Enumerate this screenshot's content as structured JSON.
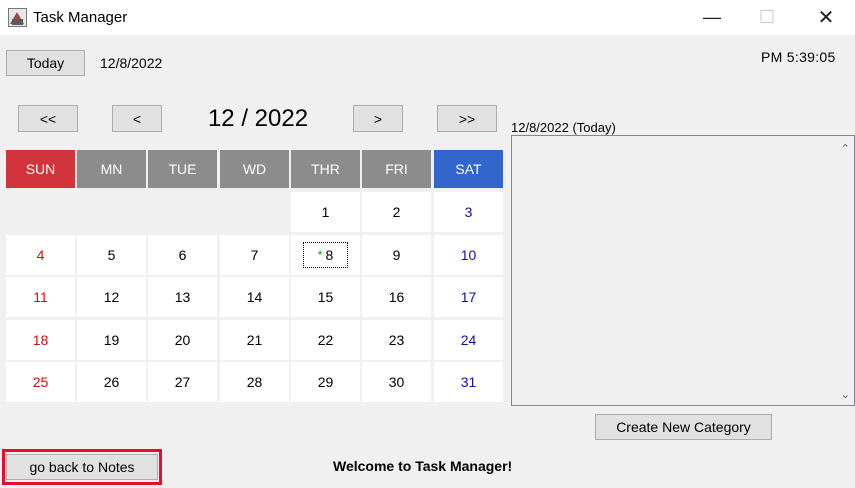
{
  "window": {
    "title": "Task Manager",
    "minimize_glyph": "—",
    "maximize_glyph": "☐",
    "close_glyph": "✕"
  },
  "toolbar": {
    "today_label": "Today",
    "current_date": "12/8/2022",
    "clock": "PM  5:39:05"
  },
  "calendar": {
    "nav": {
      "prev_year": "<<",
      "prev_month": "<",
      "next_month": ">",
      "next_year": ">>"
    },
    "month_year": "12 / 2022",
    "day_headers": [
      "SUN",
      "MN",
      "TUE",
      "WD",
      "THR",
      "FRI",
      "SAT"
    ],
    "header_colors": {
      "sun": "#d1343a",
      "weekday": "#8c8c8c",
      "sat": "#3366cc"
    },
    "weeks": [
      [
        "",
        "",
        "",
        "",
        "1",
        "2",
        "3"
      ],
      [
        "4",
        "5",
        "6",
        "7",
        "8",
        "9",
        "10"
      ],
      [
        "11",
        "12",
        "13",
        "14",
        "15",
        "16",
        "17"
      ],
      [
        "18",
        "19",
        "20",
        "21",
        "22",
        "23",
        "24"
      ],
      [
        "25",
        "26",
        "27",
        "28",
        "29",
        "30",
        "31"
      ]
    ],
    "today_day": "8",
    "today_marker": "*"
  },
  "tasks": {
    "date_label": "12/8/2022 (Today)",
    "scroll_up": "⌃",
    "scroll_down": "⌄"
  },
  "buttons": {
    "create_category": "Create New Category",
    "back_to_notes": "go back to Notes"
  },
  "status": {
    "welcome": "Welcome to Task Manager!"
  }
}
